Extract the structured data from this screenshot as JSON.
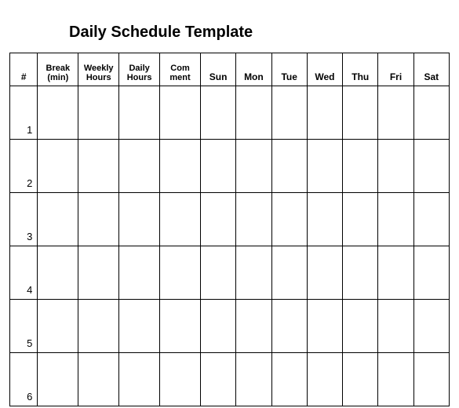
{
  "title": "Daily Schedule Template",
  "headers": {
    "num": "#",
    "break": "Break (min)",
    "weekly": "Weekly Hours",
    "daily": "Daily Hours",
    "comment": "Com ment",
    "sun": "Sun",
    "mon": "Mon",
    "tue": "Tue",
    "wed": "Wed",
    "thu": "Thu",
    "fri": "Fri",
    "sat": "Sat"
  },
  "rows": [
    {
      "n": "1"
    },
    {
      "n": "2"
    },
    {
      "n": "3"
    },
    {
      "n": "4"
    },
    {
      "n": "5"
    },
    {
      "n": "6"
    }
  ]
}
